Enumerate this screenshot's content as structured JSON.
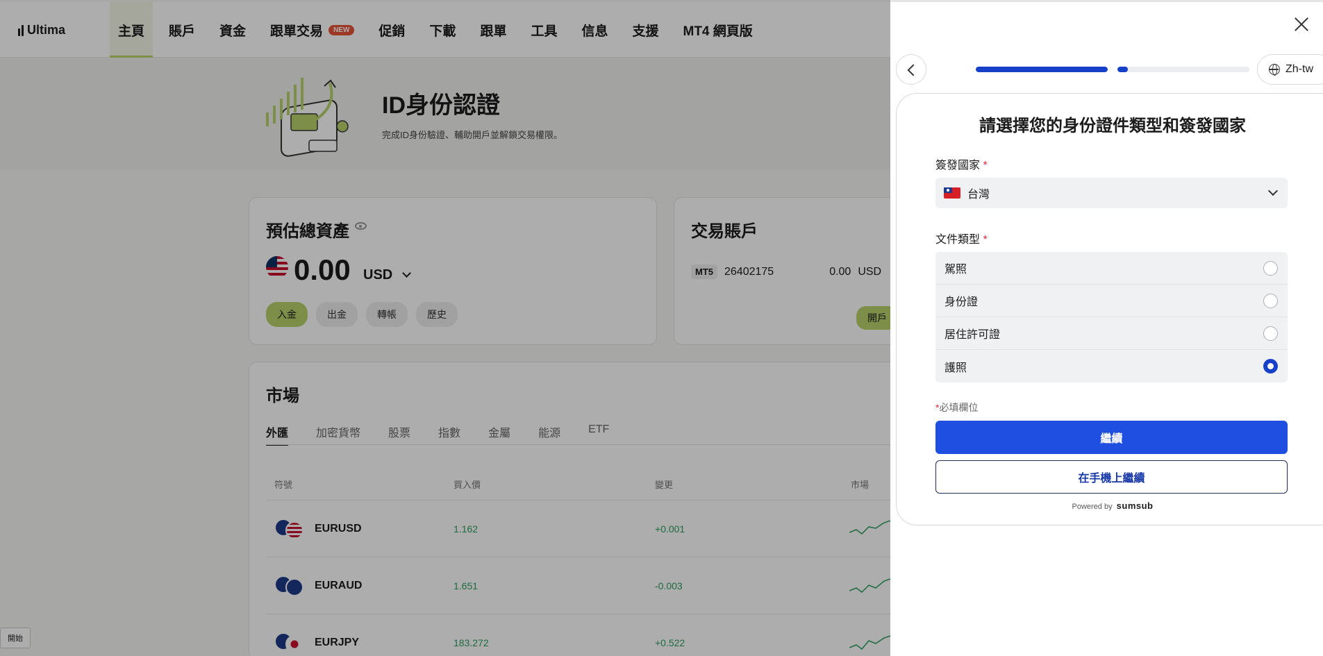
{
  "app": {
    "logo": "Ultima",
    "nav": [
      "主頁",
      "賬戶",
      "資金",
      "跟單交易",
      "促銷",
      "下載",
      "跟單",
      "工具",
      "信息",
      "支援",
      "MT4 網頁版"
    ],
    "nav_badge": "NEW",
    "hero": {
      "title": "ID身份認證",
      "subtitle": "完成ID身份驗證、輔助開戶並解鎖交易權限。"
    },
    "assets": {
      "title": "預估總資產",
      "balance": "0.00",
      "currency": "USD",
      "actions": [
        "入金",
        "出金",
        "轉帳",
        "歷史"
      ]
    },
    "trading": {
      "title": "交易賬戶",
      "platform": "MT5",
      "account": "26402175",
      "balance": "0.00",
      "currency": "USD",
      "open_label": "開戶"
    },
    "market": {
      "title": "市場",
      "tabs": [
        "外匯",
        "加密貨幣",
        "股票",
        "指數",
        "金屬",
        "能源",
        "ETF"
      ],
      "headers": [
        "符號",
        "買入價",
        "變更",
        "市場"
      ],
      "rows": [
        {
          "symbol": "EURUSD",
          "bid": "1.162",
          "change": "+0.001"
        },
        {
          "symbol": "EURAUD",
          "bid": "1.651",
          "change": "-0.003"
        },
        {
          "symbol": "EURJPY",
          "bid": "183.272",
          "change": "+0.522"
        }
      ]
    },
    "start_label": "開始"
  },
  "panel": {
    "language": "Zh-tw",
    "progress": [
      1.0,
      0.08
    ],
    "title": "請選擇您的身份證件類型和簽發國家",
    "country_label": "簽發國家",
    "country_value": "台灣",
    "doc_label": "文件類型",
    "required_mark": "*",
    "doc_options": [
      "駕照",
      "身份證",
      "居住許可證",
      "護照"
    ],
    "selected_doc": "護照",
    "required_note": "必填欄位",
    "continue_label": "繼續",
    "mobile_label": "在手機上繼續",
    "powered_by": "Powered by",
    "powered_brand": "sumsub"
  },
  "colors": {
    "primary": "#1f4fe0",
    "accent_green": "#b7d26a",
    "positive": "#2a9d5c",
    "required": "#e0283a"
  }
}
